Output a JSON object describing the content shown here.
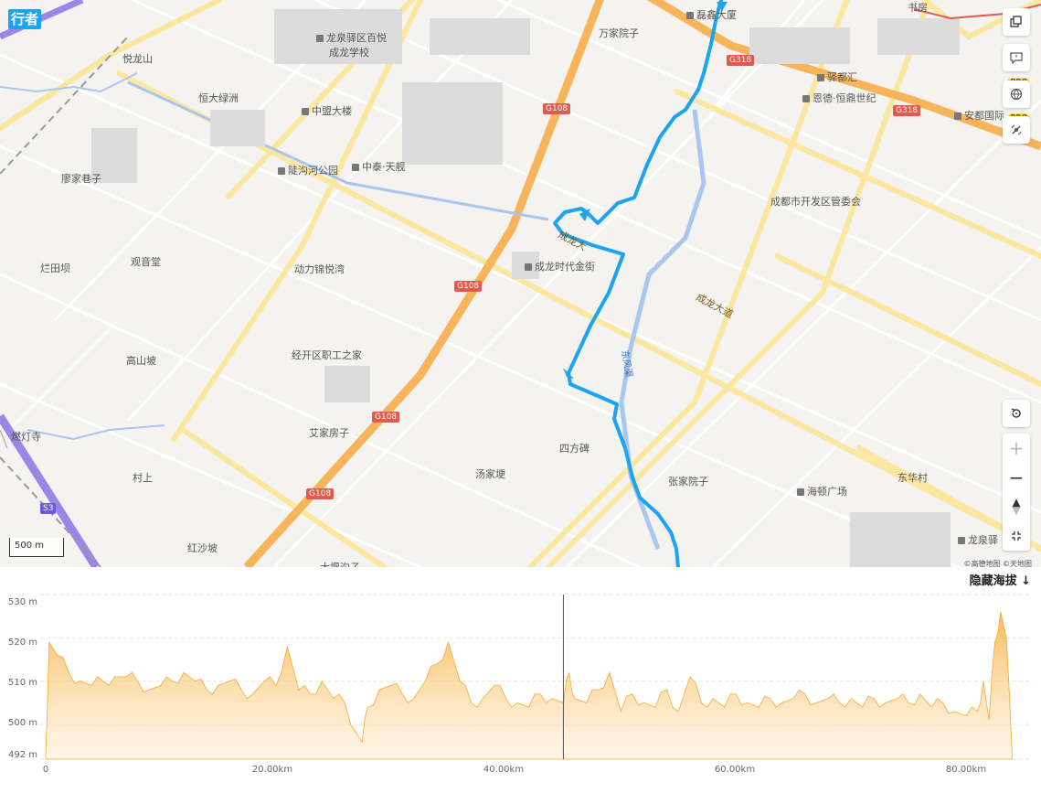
{
  "brand": {
    "label": "行者",
    "color": "#1ca3f2"
  },
  "map": {
    "route_color": "#1ca3f2",
    "labels": [
      "悦龙山",
      "恒大绿洲",
      "龙泉驿区百悦",
      "成龙学校",
      "中盟大楼",
      "陡沟河公园",
      "中泰·天舰",
      "廖家巷子",
      "烂田坝",
      "观音堂",
      "动力锦悦湾",
      "成龙时代金街",
      "万家院子",
      "磊鑫大厦",
      "驿都汇",
      "恩德·恒鼎世纪",
      "安都国际",
      "书房",
      "成都市开发区管委会",
      "成龙大道",
      "高山坡",
      "经开区职工之家",
      "燃灯寺",
      "艾家房子",
      "汤家埂",
      "四方碑",
      "张家院子",
      "海顿广场",
      "东华村",
      "村上",
      "红沙坡",
      "龙泉驿",
      "大堰沟子",
      "成龙大",
      "东风渠"
    ],
    "shields": [
      "G318",
      "G318",
      "G108",
      "G108",
      "G108",
      "G108",
      "S3"
    ],
    "scale": "500 m",
    "copyright": "©高德地图 ©天地图",
    "pro_badge": "PRO",
    "controls": {
      "layers_icon": "layers-icon",
      "feedback_icon": "feedback-icon",
      "globe_icon": "globe-icon",
      "satellite_icon": "satellite-icon",
      "reset_icon": "reset-view-icon",
      "zoom_in": "+",
      "zoom_out": "−",
      "compass": "▲",
      "fullscreen_icon": "fullscreen-icon"
    }
  },
  "elevation": {
    "toggle_label": "隐藏海拔 ↓",
    "y_ticks": [
      "530 m",
      "520 m",
      "510 m",
      "500 m",
      "492 m"
    ],
    "x_ticks": [
      "0",
      "20.00km",
      "40.00km",
      "60.00km",
      "80.00km"
    ],
    "fill_color": "#fbb64c"
  },
  "chart_data": {
    "type": "area",
    "title": "",
    "xlabel": "",
    "ylabel": "",
    "x_unit": "km",
    "y_unit": "m",
    "xlim": [
      0,
      85
    ],
    "ylim": [
      492,
      530
    ],
    "marker_x": 45,
    "x": [
      0,
      0.3,
      1,
      2,
      3,
      4,
      5,
      6,
      7,
      8,
      9,
      10,
      11,
      12,
      13,
      14,
      15,
      16,
      17,
      18,
      19,
      20,
      21,
      22,
      23,
      24,
      25,
      26,
      27,
      27.5,
      28,
      29,
      30,
      31,
      32,
      33,
      34,
      35,
      36,
      37,
      38,
      39,
      40,
      41,
      42,
      43,
      44,
      45,
      45.5,
      46,
      47,
      48,
      49,
      50,
      51,
      52,
      53,
      54,
      55,
      56,
      57,
      58,
      59,
      60,
      61,
      62,
      63,
      64,
      65,
      66,
      67,
      68,
      69,
      70,
      71,
      72,
      73,
      74,
      75,
      76,
      77,
      78,
      79,
      80,
      81,
      81.5,
      82,
      82.5,
      83,
      83.5,
      84
    ],
    "values": [
      493,
      519,
      516,
      512,
      510,
      509,
      510,
      511,
      511,
      510,
      508,
      509,
      510,
      512,
      510,
      508,
      509,
      510,
      508,
      507,
      510,
      509,
      518,
      508,
      507,
      510,
      506,
      505,
      498,
      496,
      504,
      508,
      509,
      507,
      506,
      510,
      514,
      519,
      510,
      505,
      506,
      509,
      506,
      505,
      504,
      507,
      506,
      505,
      512,
      506,
      505,
      508,
      512,
      503,
      507,
      505,
      504,
      508,
      503,
      511,
      505,
      506,
      504,
      507,
      505,
      504,
      506,
      505,
      506,
      507,
      505,
      506,
      505,
      506,
      504,
      506,
      505,
      506,
      505,
      507,
      504,
      505,
      503,
      502,
      503,
      510,
      501,
      519,
      526,
      520,
      493
    ]
  }
}
